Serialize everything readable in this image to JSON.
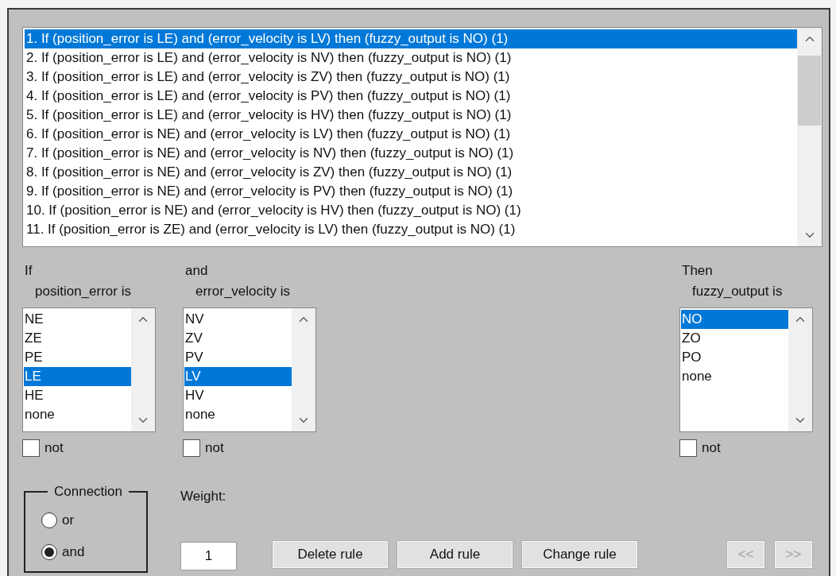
{
  "rules": [
    {
      "text": "1. If (position_error is LE) and (error_velocity is LV) then (fuzzy_output is NO) (1)",
      "selected": true
    },
    {
      "text": "2. If (position_error is LE) and (error_velocity is NV) then (fuzzy_output is NO) (1)",
      "selected": false
    },
    {
      "text": "3. If (position_error is LE) and (error_velocity is ZV) then (fuzzy_output is NO) (1)",
      "selected": false
    },
    {
      "text": "4. If (position_error is LE) and (error_velocity is PV) then (fuzzy_output is NO) (1)",
      "selected": false
    },
    {
      "text": "5. If (position_error is LE) and (error_velocity is HV) then (fuzzy_output is NO) (1)",
      "selected": false
    },
    {
      "text": "6. If (position_error is NE) and (error_velocity is LV) then (fuzzy_output is NO) (1)",
      "selected": false
    },
    {
      "text": "7. If (position_error is NE) and (error_velocity is NV) then (fuzzy_output is NO) (1)",
      "selected": false
    },
    {
      "text": "8. If (position_error is NE) and (error_velocity is ZV) then (fuzzy_output is NO) (1)",
      "selected": false
    },
    {
      "text": "9. If (position_error is NE) and (error_velocity is PV) then (fuzzy_output is NO) (1)",
      "selected": false
    },
    {
      "text": "10. If (position_error is NE) and (error_velocity is HV) then (fuzzy_output is NO) (1)",
      "selected": false
    },
    {
      "text": "11. If (position_error is ZE) and (error_velocity is LV) then (fuzzy_output is NO) (1)",
      "selected": false
    }
  ],
  "antecedents": [
    {
      "label": "If",
      "variable": "position_error is",
      "not_label": "not",
      "not": false,
      "options": [
        {
          "label": "NE",
          "selected": false
        },
        {
          "label": "ZE",
          "selected": false
        },
        {
          "label": "PE",
          "selected": false
        },
        {
          "label": "LE",
          "selected": true
        },
        {
          "label": "HE",
          "selected": false
        },
        {
          "label": "none",
          "selected": false
        }
      ]
    },
    {
      "label": "and",
      "variable": "error_velocity is",
      "not_label": "not",
      "not": false,
      "options": [
        {
          "label": "NV",
          "selected": false
        },
        {
          "label": "ZV",
          "selected": false
        },
        {
          "label": "PV",
          "selected": false
        },
        {
          "label": "LV",
          "selected": true
        },
        {
          "label": "HV",
          "selected": false
        },
        {
          "label": "none",
          "selected": false
        }
      ]
    }
  ],
  "consequent": {
    "label": "Then",
    "variable": "fuzzy_output is",
    "not_label": "not",
    "not": false,
    "options": [
      {
        "label": "NO",
        "selected": true
      },
      {
        "label": "ZO",
        "selected": false
      },
      {
        "label": "PO",
        "selected": false
      },
      {
        "label": "none",
        "selected": false
      }
    ]
  },
  "connection": {
    "title": "Connection",
    "options": [
      {
        "label": "or",
        "selected": false
      },
      {
        "label": "and",
        "selected": true
      }
    ]
  },
  "weight": {
    "label": "Weight:",
    "value": "1"
  },
  "buttons": [
    {
      "label": "Delete rule",
      "disabled": false
    },
    {
      "label": "Add rule",
      "disabled": false
    },
    {
      "label": "Change rule",
      "disabled": false
    }
  ],
  "nav": [
    {
      "label": "<<",
      "disabled": true
    },
    {
      "label": ">>",
      "disabled": true
    }
  ]
}
